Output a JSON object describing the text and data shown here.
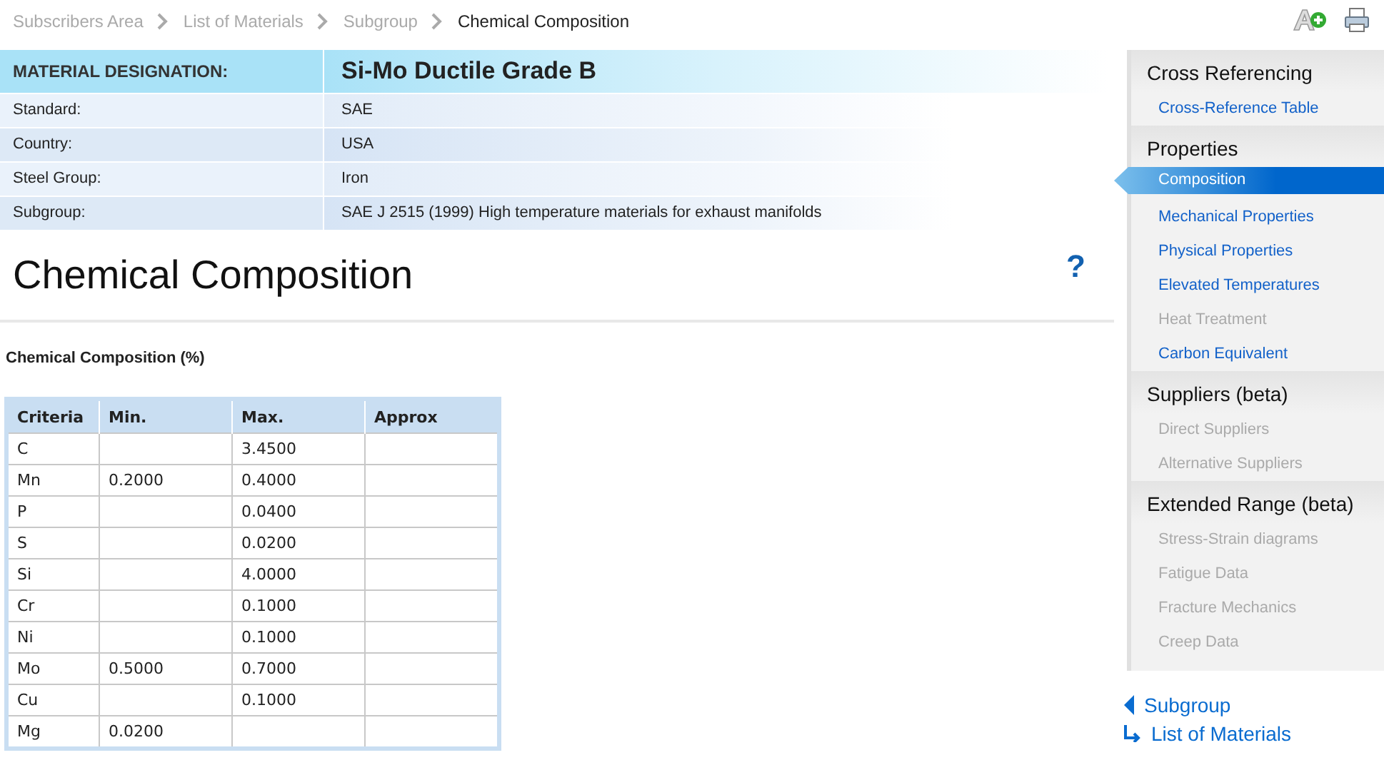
{
  "breadcrumb": [
    {
      "label": "Subscribers Area",
      "current": false
    },
    {
      "label": "List of Materials",
      "current": false
    },
    {
      "label": "Subgroup",
      "current": false
    },
    {
      "label": "Chemical Composition",
      "current": true
    }
  ],
  "designation": {
    "label": "MATERIAL DESIGNATION:",
    "value": "Si-Mo Ductile Grade B"
  },
  "details": [
    {
      "label": "Standard:",
      "value": "SAE"
    },
    {
      "label": "Country:",
      "value": "USA"
    },
    {
      "label": "Steel Group:",
      "value": "Iron"
    },
    {
      "label": "Subgroup:",
      "value": "SAE J 2515 (1999) High temperature materials for exhaust manifolds"
    }
  ],
  "page_title": "Chemical Composition",
  "help": "?",
  "table": {
    "caption": "Chemical Composition (%)",
    "columns": [
      "Criteria",
      "Min.",
      "Max.",
      "Approx"
    ],
    "rows": [
      {
        "criteria": "C",
        "max": "3.4500"
      },
      {
        "criteria": "Mn",
        "min": "0.2000",
        "max": "0.4000"
      },
      {
        "criteria": "P",
        "max": "0.0400"
      },
      {
        "criteria": "S",
        "max": "0.0200"
      },
      {
        "criteria": "Si",
        "max": "4.0000"
      },
      {
        "criteria": "Cr",
        "max": "0.1000"
      },
      {
        "criteria": "Ni",
        "max": "0.1000"
      },
      {
        "criteria": "Mo",
        "min": "0.5000",
        "max": "0.7000"
      },
      {
        "criteria": "Cu",
        "max": "0.1000"
      },
      {
        "criteria": "Mg",
        "min": "0.0200"
      }
    ]
  },
  "sidebar": {
    "sections": [
      {
        "title": "Cross Referencing",
        "items": [
          {
            "label": "Cross-Reference Table",
            "disabled": false,
            "selected": false
          }
        ]
      },
      {
        "title": "Properties",
        "items": [
          {
            "label": "Composition",
            "disabled": false,
            "selected": true
          },
          {
            "label": "Mechanical Properties",
            "disabled": false,
            "selected": false
          },
          {
            "label": "Physical Properties",
            "disabled": false,
            "selected": false
          },
          {
            "label": "Elevated Temperatures",
            "disabled": false,
            "selected": false
          },
          {
            "label": "Heat Treatment",
            "disabled": true,
            "selected": false
          },
          {
            "label": "Carbon Equivalent",
            "disabled": false,
            "selected": false
          }
        ]
      },
      {
        "title": "Suppliers (beta)",
        "items": [
          {
            "label": "Direct Suppliers",
            "disabled": true,
            "selected": false
          },
          {
            "label": "Alternative Suppliers",
            "disabled": true,
            "selected": false
          }
        ]
      },
      {
        "title": "Extended Range (beta)",
        "items": [
          {
            "label": "Stress-Strain diagrams",
            "disabled": true,
            "selected": false
          },
          {
            "label": "Fatigue Data",
            "disabled": true,
            "selected": false
          },
          {
            "label": "Fracture Mechanics",
            "disabled": true,
            "selected": false
          },
          {
            "label": "Creep Data",
            "disabled": true,
            "selected": false
          }
        ]
      }
    ]
  },
  "bottom_links": [
    {
      "kind": "back",
      "label": "Subgroup"
    },
    {
      "kind": "up",
      "label": "List of Materials"
    }
  ]
}
